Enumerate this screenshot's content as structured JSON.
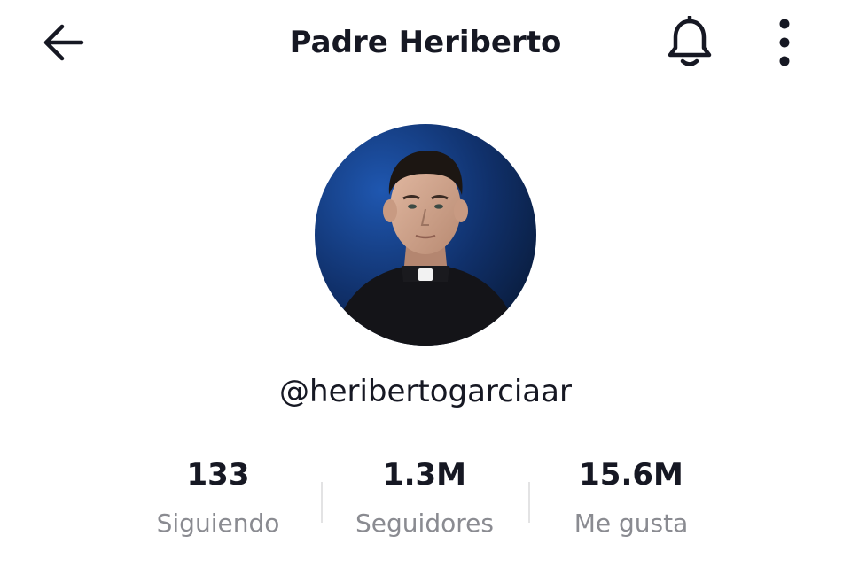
{
  "header": {
    "title": "Padre Heriberto",
    "back_icon": "arrow-left-icon",
    "notification_icon": "bell-icon",
    "more_icon": "more-vertical-icon"
  },
  "profile": {
    "username": "@heribertogarciaar",
    "avatar_icon": "profile-photo"
  },
  "stats": [
    {
      "value": "133",
      "label": "Siguiendo"
    },
    {
      "value": "1.3M",
      "label": "Seguidores"
    },
    {
      "value": "15.6M",
      "label": "Me gusta"
    }
  ],
  "colors": {
    "text_primary": "#161823",
    "text_secondary": "#8a8b91",
    "divider": "#e3e3e4",
    "background": "#ffffff"
  }
}
